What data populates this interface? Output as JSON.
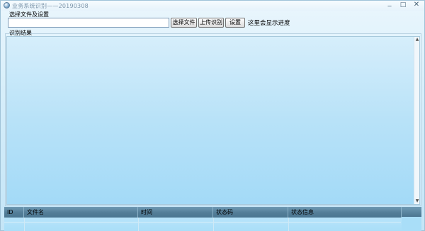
{
  "window": {
    "title": "业务系统识别——20190308",
    "icon": "app-globe-icon",
    "controls": [
      "minimize-icon",
      "maximize-icon",
      "close-icon"
    ]
  },
  "file_group": {
    "label": "选择文件及设置",
    "file_input_value": "",
    "select_button": "选择文件",
    "upload_button": "上传识别",
    "settings_button": "设置",
    "progress_text": "这里会显示进度"
  },
  "result_group": {
    "label": "识别结果",
    "content": ""
  },
  "table": {
    "columns": [
      "ID",
      "文件名",
      "时间",
      "状态码",
      "状态信息"
    ],
    "rows": []
  },
  "colors": {
    "background": "#d6eefa",
    "result_area": "#b8e2f8",
    "grid_header": "#557f99"
  }
}
